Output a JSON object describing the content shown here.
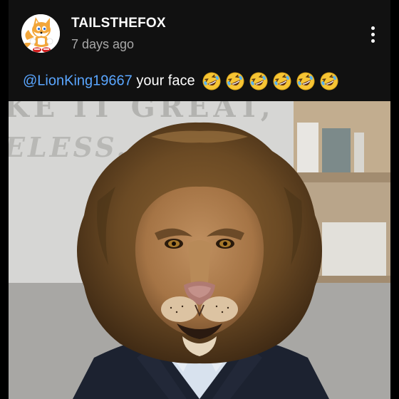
{
  "post": {
    "username": "TAILSTHEFOX",
    "timestamp": "7 days ago",
    "caption": {
      "mention": "@LionKing19667",
      "text": " your face",
      "emoji_icon": "rolling-on-floor-laughing-emoji",
      "emoji_count": 6
    },
    "photo": {
      "poster_text_line1": "KE IT GREAT,",
      "poster_text_line2": "ELESS."
    }
  },
  "colors": {
    "background": "#000000",
    "card": "#111111",
    "mention": "#5aa6ff",
    "timestamp": "#a8a8a8"
  },
  "icons": {
    "more": "vertical-ellipsis-icon",
    "avatar": "tails-fox-avatar"
  }
}
